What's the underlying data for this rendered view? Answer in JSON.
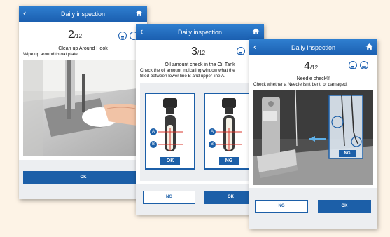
{
  "screens": [
    {
      "header_title": "Daily inspection",
      "step_number": "2",
      "step_total": "/12",
      "heading": "Clean up Around Hook",
      "description": "Wipe up around throat plate.",
      "ok_label": "OK"
    },
    {
      "header_title": "Daily inspection",
      "step_number": "3",
      "step_total": "/12",
      "heading": "Oil amount check in the Oil Tank",
      "description_line1": "Check the oil amount indicating window what the",
      "description_line2": "filled between lower line B and upper line A.",
      "gauge_ok_label": "OK",
      "gauge_ng_label": "NG",
      "marker_a": "A",
      "marker_b": "B",
      "ng_label": "NG",
      "ok_label": "OK"
    },
    {
      "header_title": "Daily inspection",
      "step_number": "4",
      "step_total": "/12",
      "heading": "Needle check®",
      "description": "Check whether a Needle isn't bent, or damaged.",
      "photo_ng_label": "NG",
      "ng_label": "NG",
      "ok_label": "OK"
    }
  ],
  "colors": {
    "background": "#fdf3e6",
    "header": "#1b5fb0",
    "ok_button": "#1c5fa8",
    "marker_red": "#d9342b"
  },
  "icons": [
    "back-arrow-icon",
    "home-icon",
    "document-icon",
    "camera-icon"
  ]
}
